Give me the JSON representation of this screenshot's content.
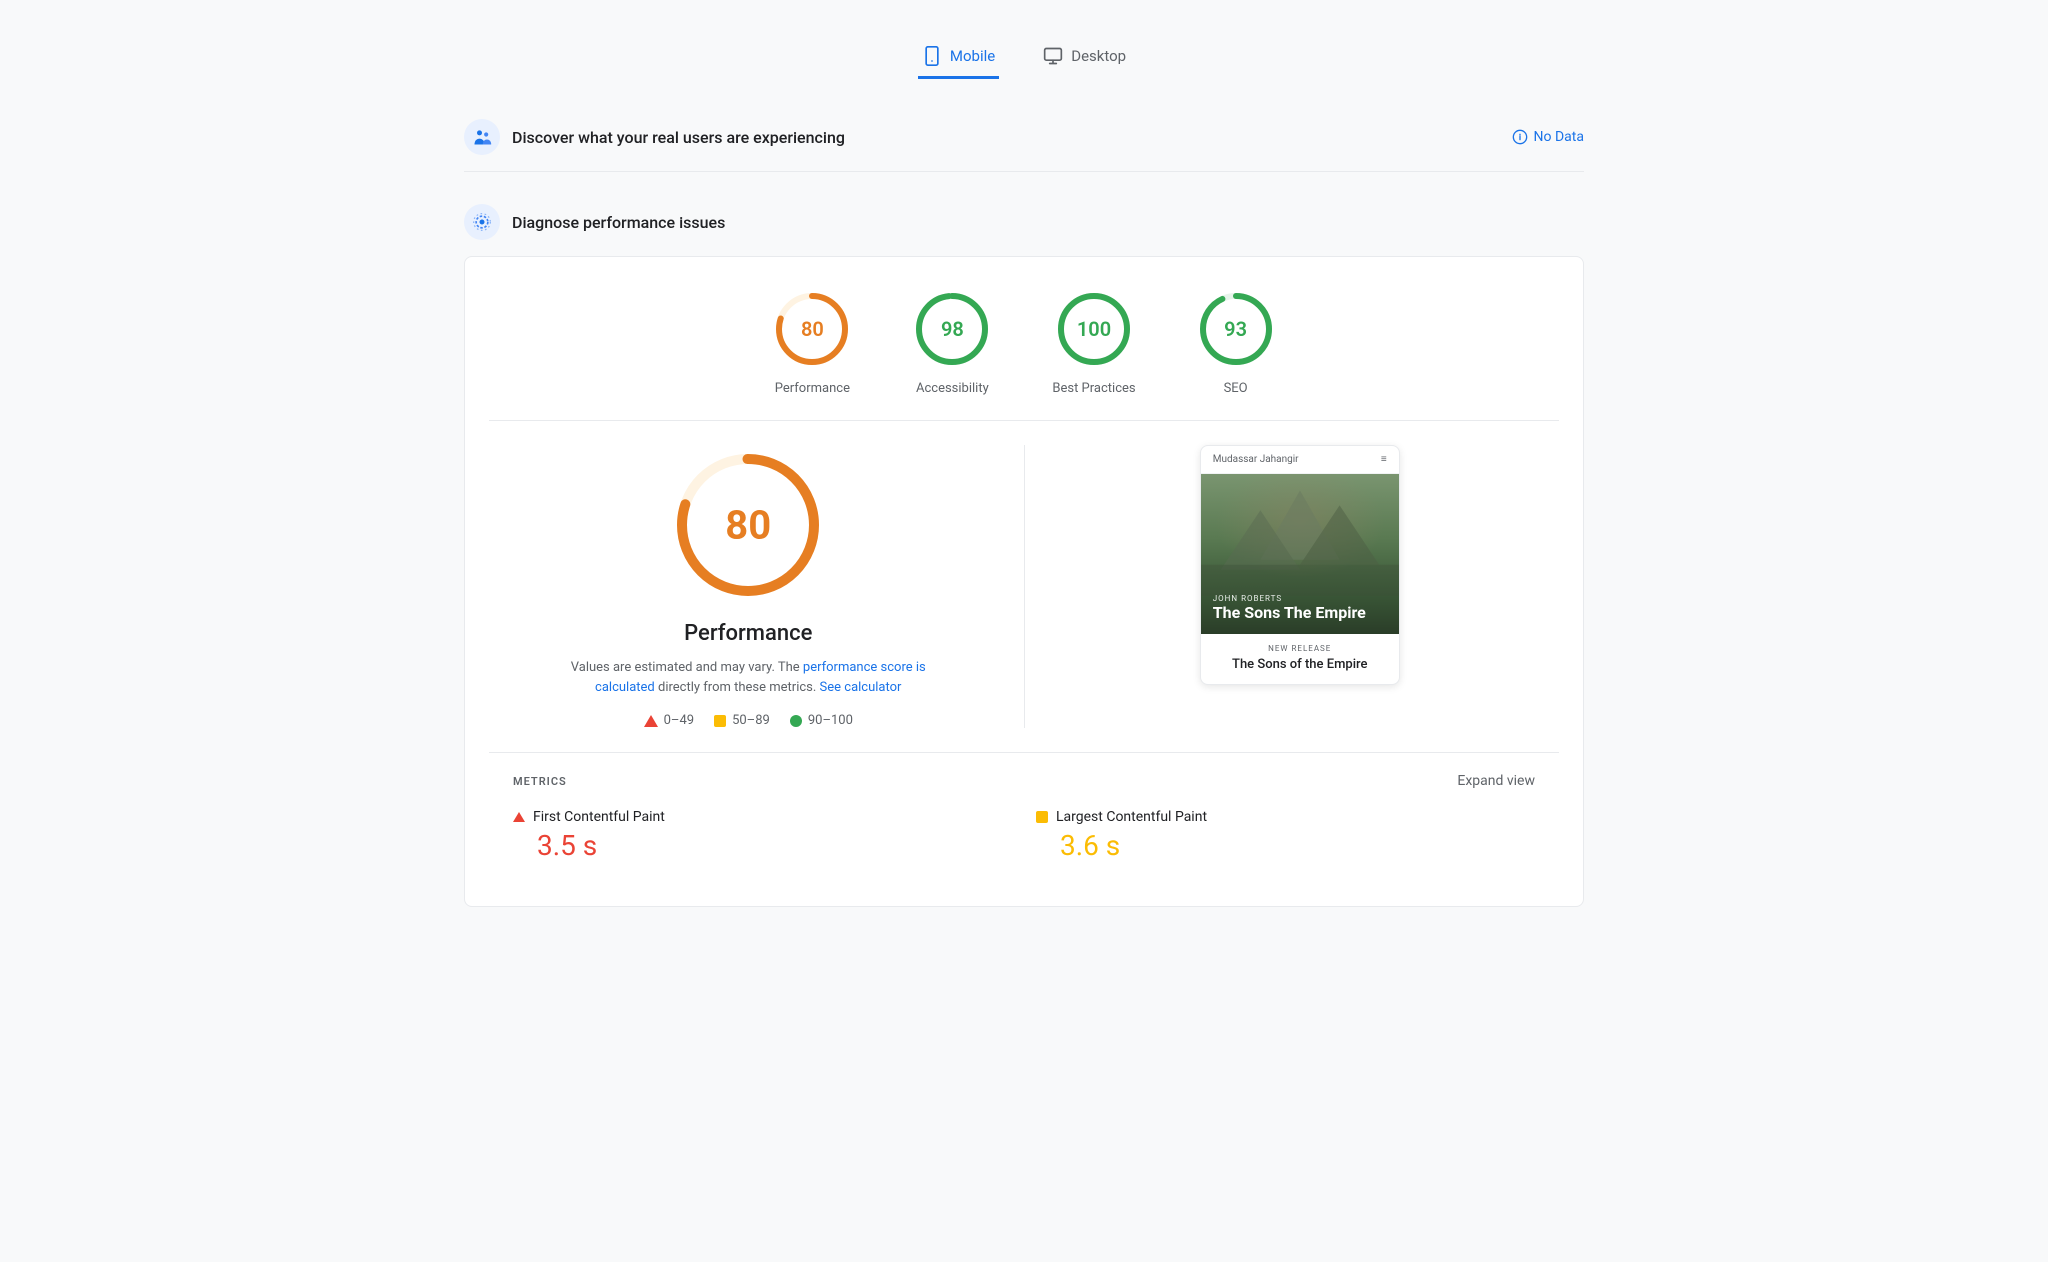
{
  "tabs": [
    {
      "id": "mobile",
      "label": "Mobile",
      "active": true
    },
    {
      "id": "desktop",
      "label": "Desktop",
      "active": false
    }
  ],
  "sections": {
    "real_users": {
      "title": "Discover what your real users are experiencing",
      "no_data_label": "No Data"
    },
    "diagnose": {
      "title": "Diagnose performance issues"
    }
  },
  "scores": [
    {
      "id": "performance",
      "value": 80,
      "label": "Performance",
      "color": "#e67e22",
      "bg": "#fef3e2",
      "dash": 188,
      "gap": 251
    },
    {
      "id": "accessibility",
      "value": 98,
      "label": "Accessibility",
      "color": "#34a853",
      "bg": "#e6f4ea",
      "dash": 244,
      "gap": 7
    },
    {
      "id": "best_practices",
      "value": 100,
      "label": "Best Practices",
      "color": "#34a853",
      "bg": "#e6f4ea",
      "dash": 251,
      "gap": 0
    },
    {
      "id": "seo",
      "value": 93,
      "label": "SEO",
      "color": "#34a853",
      "bg": "#e6f4ea",
      "dash": 233,
      "gap": 18
    }
  ],
  "performance_detail": {
    "score": 80,
    "title": "Performance",
    "description_start": "Values are estimated and may vary. The",
    "description_link": "performance score is calculated",
    "description_mid": "directly from these metrics.",
    "calculator_link": "See calculator",
    "description_end": ""
  },
  "legend": [
    {
      "type": "triangle",
      "range": "0–49",
      "color": "#ea4335"
    },
    {
      "type": "square",
      "range": "50–89",
      "color": "#fbbc04"
    },
    {
      "type": "circle",
      "range": "90–100",
      "color": "#34a853"
    }
  ],
  "book_preview": {
    "author_header": "Mudassar Jahangir",
    "menu_icon": "≡",
    "author_small": "JOHN ROBERTS",
    "title_cover": "The Sons The Empire",
    "new_release_label": "NEW RELEASE",
    "title_footer": "The Sons of the Empire"
  },
  "metrics": {
    "section_title": "METRICS",
    "expand_label": "Expand view",
    "items": [
      {
        "id": "fcp",
        "label": "First Contentful Paint",
        "value": "3.5 s",
        "icon": "triangle",
        "color": "#ea4335"
      },
      {
        "id": "lcp",
        "label": "Largest Contentful Paint",
        "value": "3.6 s",
        "icon": "square",
        "color": "#fbbc04"
      }
    ]
  }
}
